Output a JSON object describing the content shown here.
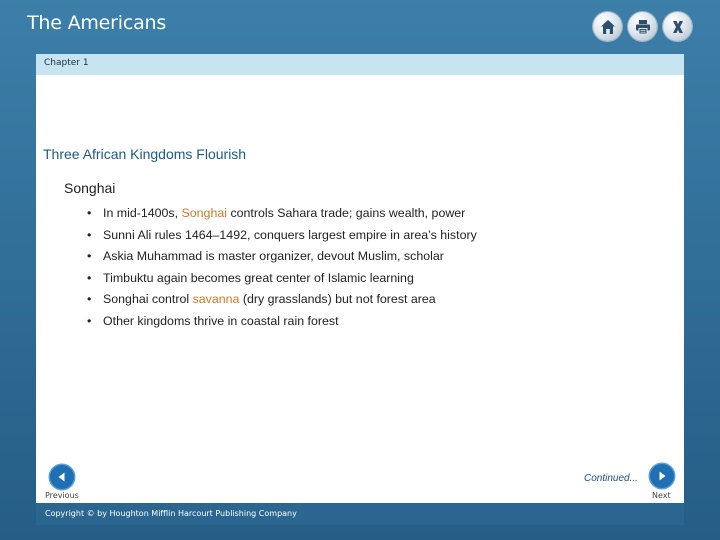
{
  "header": {
    "app_title": "The Americans",
    "icons": [
      "home-icon",
      "print-icon",
      "close-icon"
    ]
  },
  "chapter": {
    "label": "Chapter 1"
  },
  "slide": {
    "title": "Three African Kingdoms Flourish",
    "subheading": "Songhai",
    "bullets": [
      {
        "pre": "In mid-1400s, ",
        "hl": "Songhai",
        "post": " controls Sahara trade; gains wealth, power"
      },
      {
        "pre": "Sunni Ali rules 1464–1492, conquers largest empire in area’s history",
        "hl": "",
        "post": ""
      },
      {
        "pre": "Askia Muhammad is master organizer, devout Muslim, scholar",
        "hl": "",
        "post": ""
      },
      {
        "pre": "Timbuktu again becomes great center of Islamic learning",
        "hl": "",
        "post": ""
      },
      {
        "pre": "Songhai control ",
        "hl": "savanna",
        "post": " (dry grasslands) but not forest area"
      },
      {
        "pre": "Other kingdoms thrive in coastal rain forest",
        "hl": "",
        "post": ""
      }
    ],
    "highlight_color": "#c9792b"
  },
  "navigation": {
    "continued": "Continued...",
    "previous_label": "Previous",
    "next_label": "Next"
  },
  "footer": {
    "copyright": "Copyright © by Houghton Mifflin Harcourt Publishing Company"
  }
}
